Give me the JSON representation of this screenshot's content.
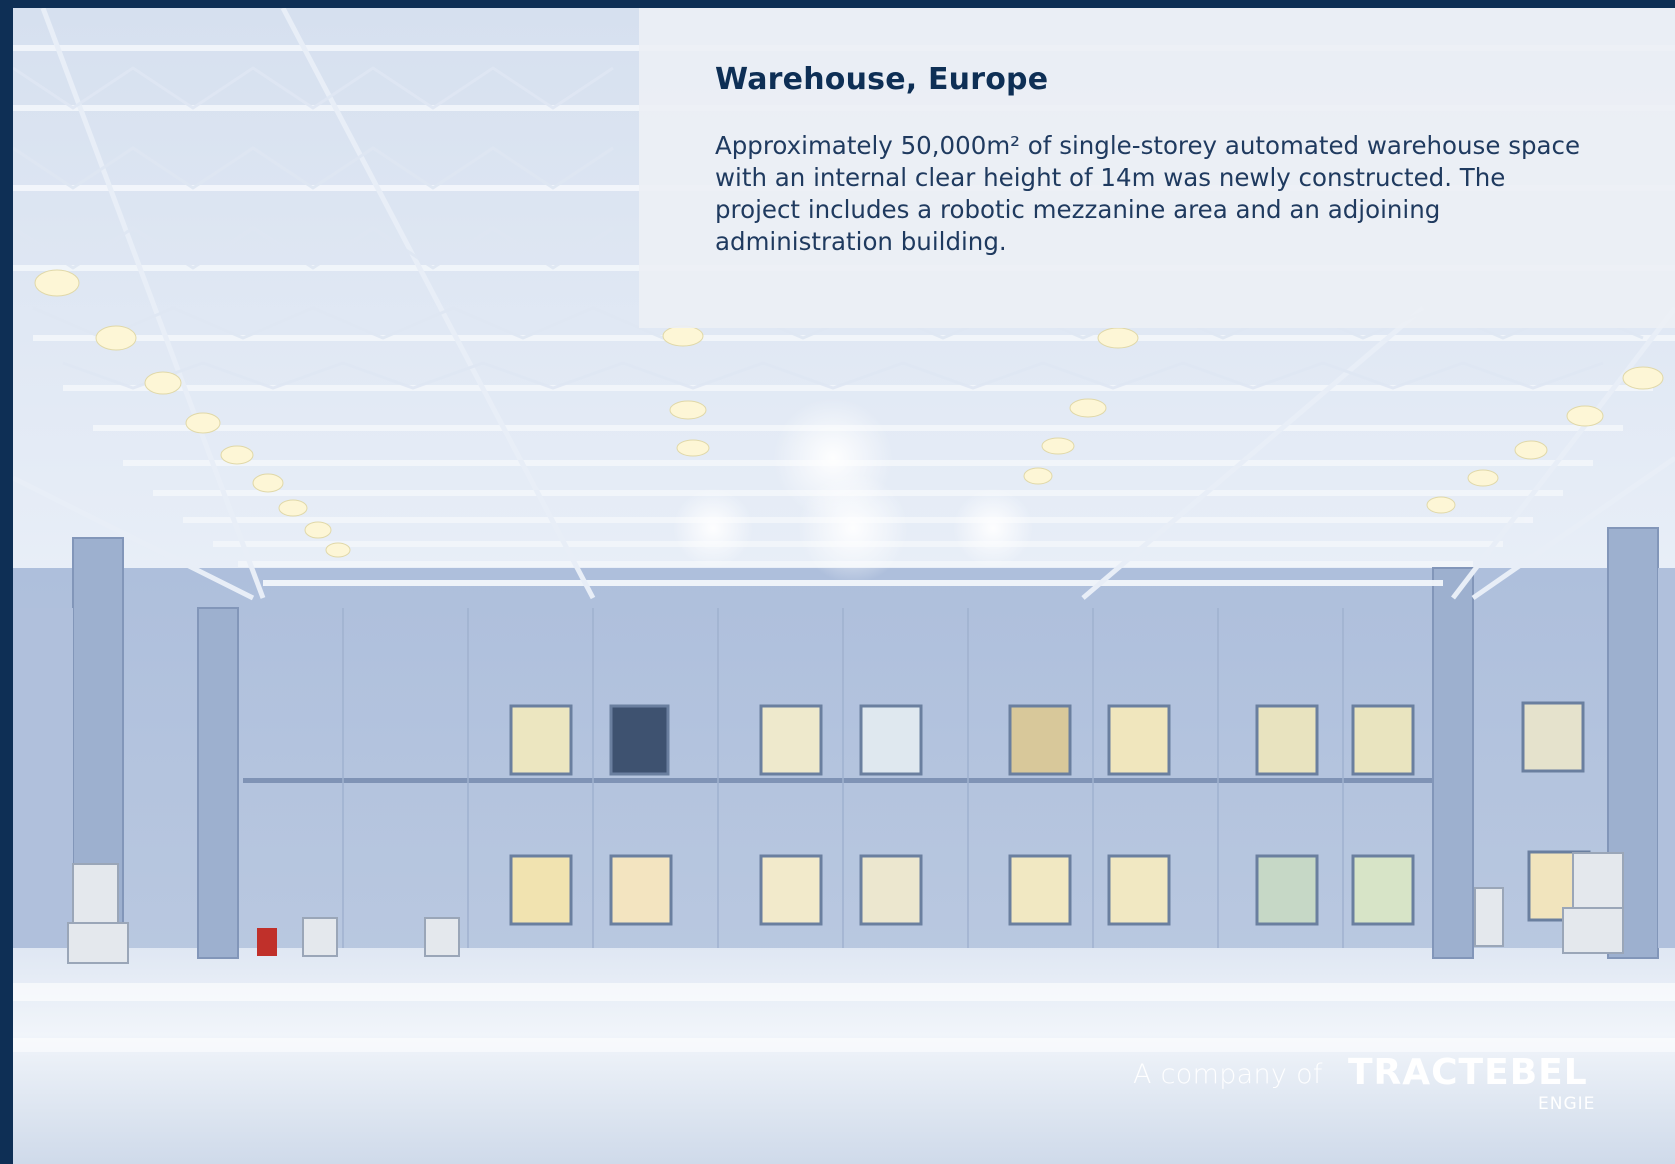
{
  "slide": {
    "title": "Warehouse, Europe",
    "description": "Approximately 50,000m² of single-storey automated warehouse space with an internal clear height of 14m was newly constructed. The project includes a robotic mezzanine area and an adjoining administration building."
  },
  "branding": {
    "prefix": "A company of",
    "logo_text": "TRACTEBEL",
    "sub_logo_text": "ENGIE"
  },
  "colors": {
    "frame": "#0e2f55",
    "title": "#0e2f55",
    "body_text": "#1f3a5f",
    "panel": "#ecf0f5"
  }
}
